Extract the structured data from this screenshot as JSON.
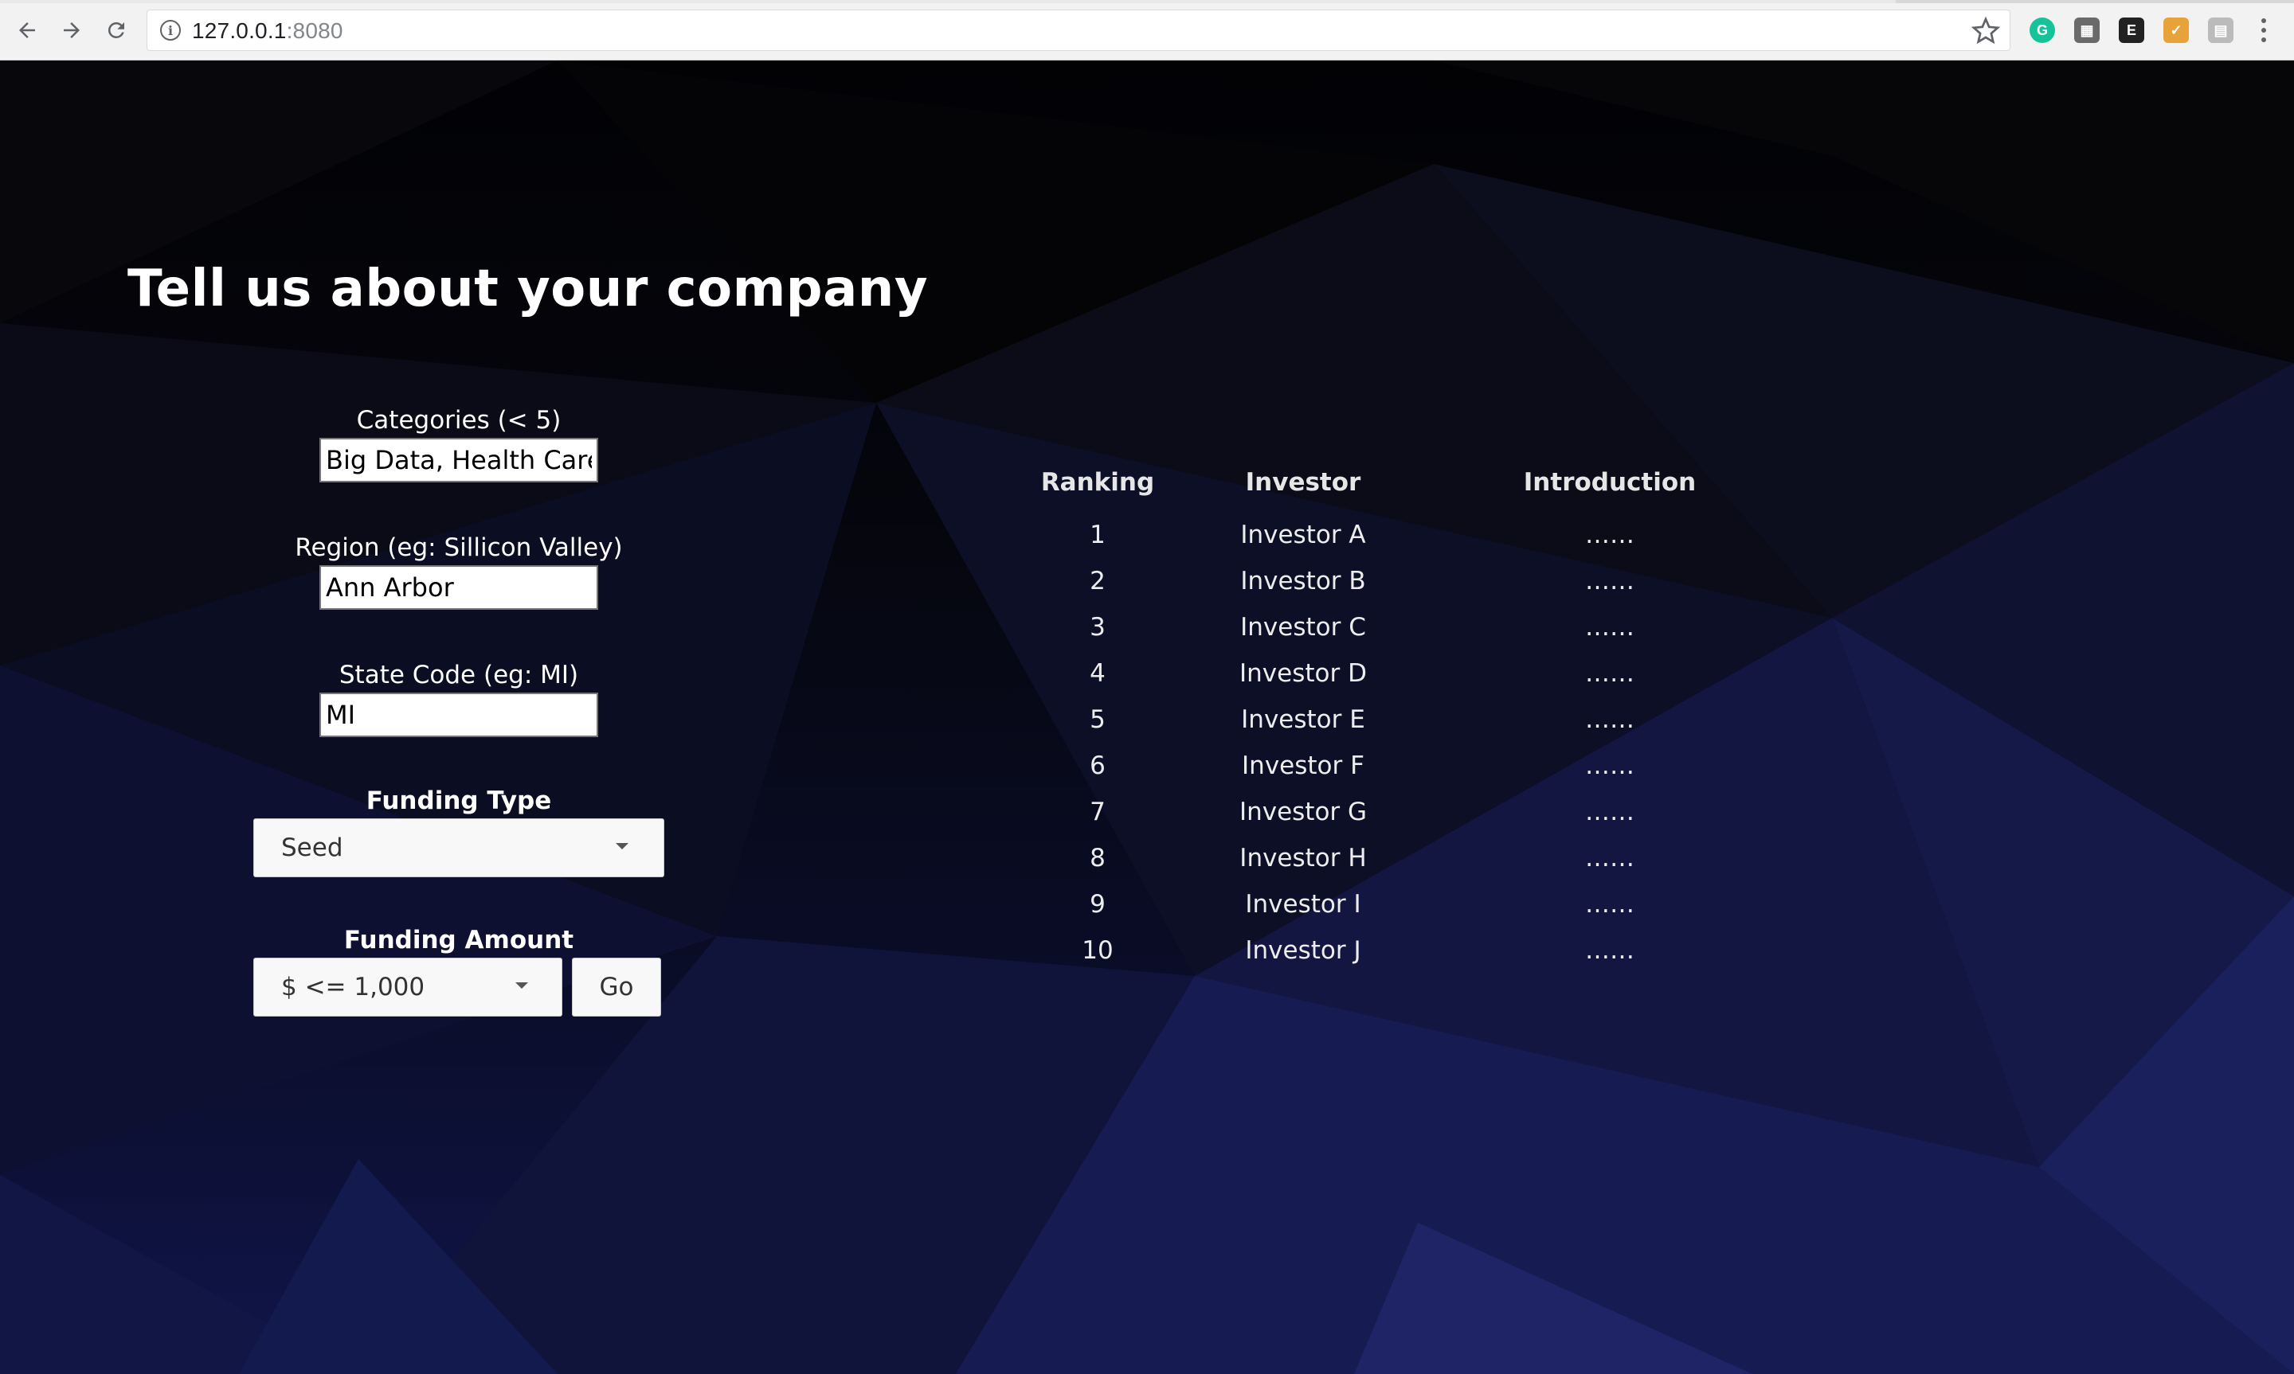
{
  "browser": {
    "url_host": "127.0.0.1",
    "url_port": ":8080",
    "extensions": [
      {
        "name": "grammarly-icon",
        "letter": "G",
        "color": "#15c39a"
      },
      {
        "name": "extension-puzzle-icon",
        "letter": "▦",
        "color": "#6a6a6a"
      },
      {
        "name": "evernote-icon",
        "letter": "E",
        "color": "#222222"
      },
      {
        "name": "clipper-icon",
        "letter": "✓",
        "color": "#e8a23a"
      },
      {
        "name": "reader-icon",
        "letter": "▤",
        "color": "#bbbbbb"
      }
    ]
  },
  "page": {
    "headline": "Tell us about your company"
  },
  "form": {
    "categories": {
      "label": "Categories (< 5)",
      "value": "Big Data, Health Care,"
    },
    "region": {
      "label": "Region (eg: Sillicon Valley)",
      "value": "Ann Arbor"
    },
    "state": {
      "label": "State Code (eg: MI)",
      "value": "MI"
    },
    "funding_type": {
      "label": "Funding Type",
      "selected": "Seed"
    },
    "funding_amount": {
      "label": "Funding Amount",
      "selected": "$ <= 1,000"
    },
    "go_label": "Go"
  },
  "results": {
    "headers": {
      "ranking": "Ranking",
      "investor": "Investor",
      "introduction": "Introduction"
    },
    "rows": [
      {
        "rank": "1",
        "investor": "Investor A",
        "intro": "……"
      },
      {
        "rank": "2",
        "investor": "Investor B",
        "intro": "……"
      },
      {
        "rank": "3",
        "investor": "Investor C",
        "intro": "……"
      },
      {
        "rank": "4",
        "investor": "Investor D",
        "intro": "……"
      },
      {
        "rank": "5",
        "investor": "Investor E",
        "intro": "……"
      },
      {
        "rank": "6",
        "investor": "Investor F",
        "intro": "……"
      },
      {
        "rank": "7",
        "investor": "Investor G",
        "intro": "……"
      },
      {
        "rank": "8",
        "investor": "Investor H",
        "intro": "……"
      },
      {
        "rank": "9",
        "investor": "Investor I",
        "intro": "……"
      },
      {
        "rank": "10",
        "investor": "Investor J",
        "intro": "……"
      }
    ]
  }
}
